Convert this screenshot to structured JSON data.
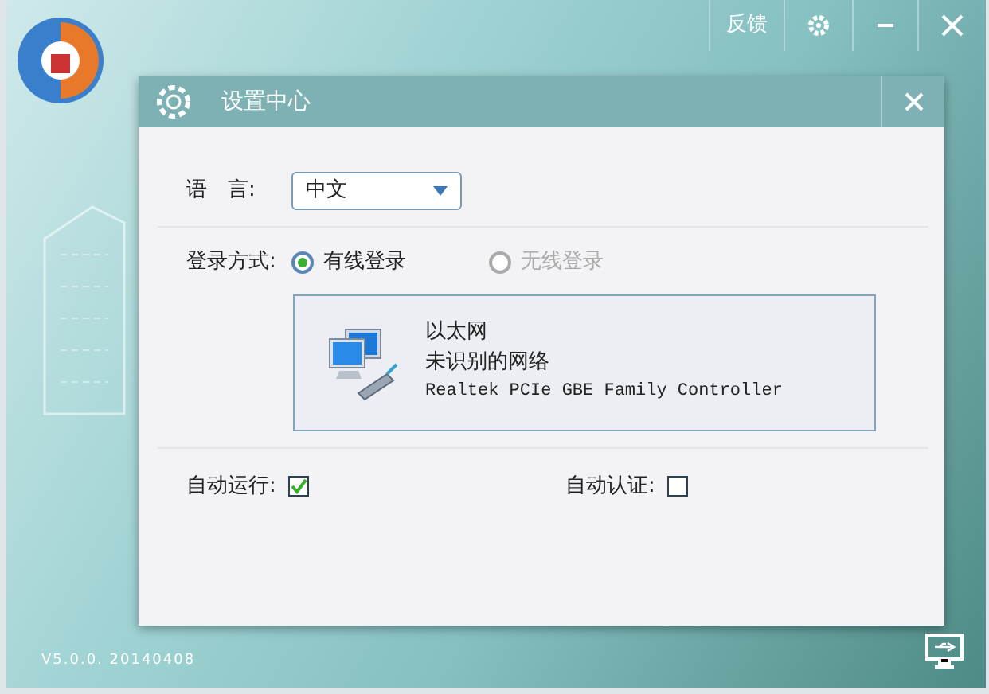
{
  "app": {
    "title_buttons": [
      {
        "kind": "text",
        "label": "反馈"
      },
      {
        "kind": "settings"
      },
      {
        "kind": "minimize"
      },
      {
        "kind": "close"
      }
    ],
    "version": "V5.0.0. 20140408"
  },
  "dialog": {
    "title": "设置中心",
    "language": {
      "label": "语　言:",
      "value": "中文"
    },
    "login": {
      "label": "登录方式:",
      "options": [
        {
          "label": "有线登录",
          "selected": true,
          "disabled": false
        },
        {
          "label": "无线登录",
          "selected": false,
          "disabled": true
        }
      ]
    },
    "adapter": {
      "name": "以太网",
      "status": "未识别的网络",
      "description": "Realtek PCIe GBE Family Controller"
    },
    "options": [
      {
        "label": "自动运行:",
        "checked": true
      },
      {
        "label": "自动认证:",
        "checked": false
      }
    ]
  }
}
